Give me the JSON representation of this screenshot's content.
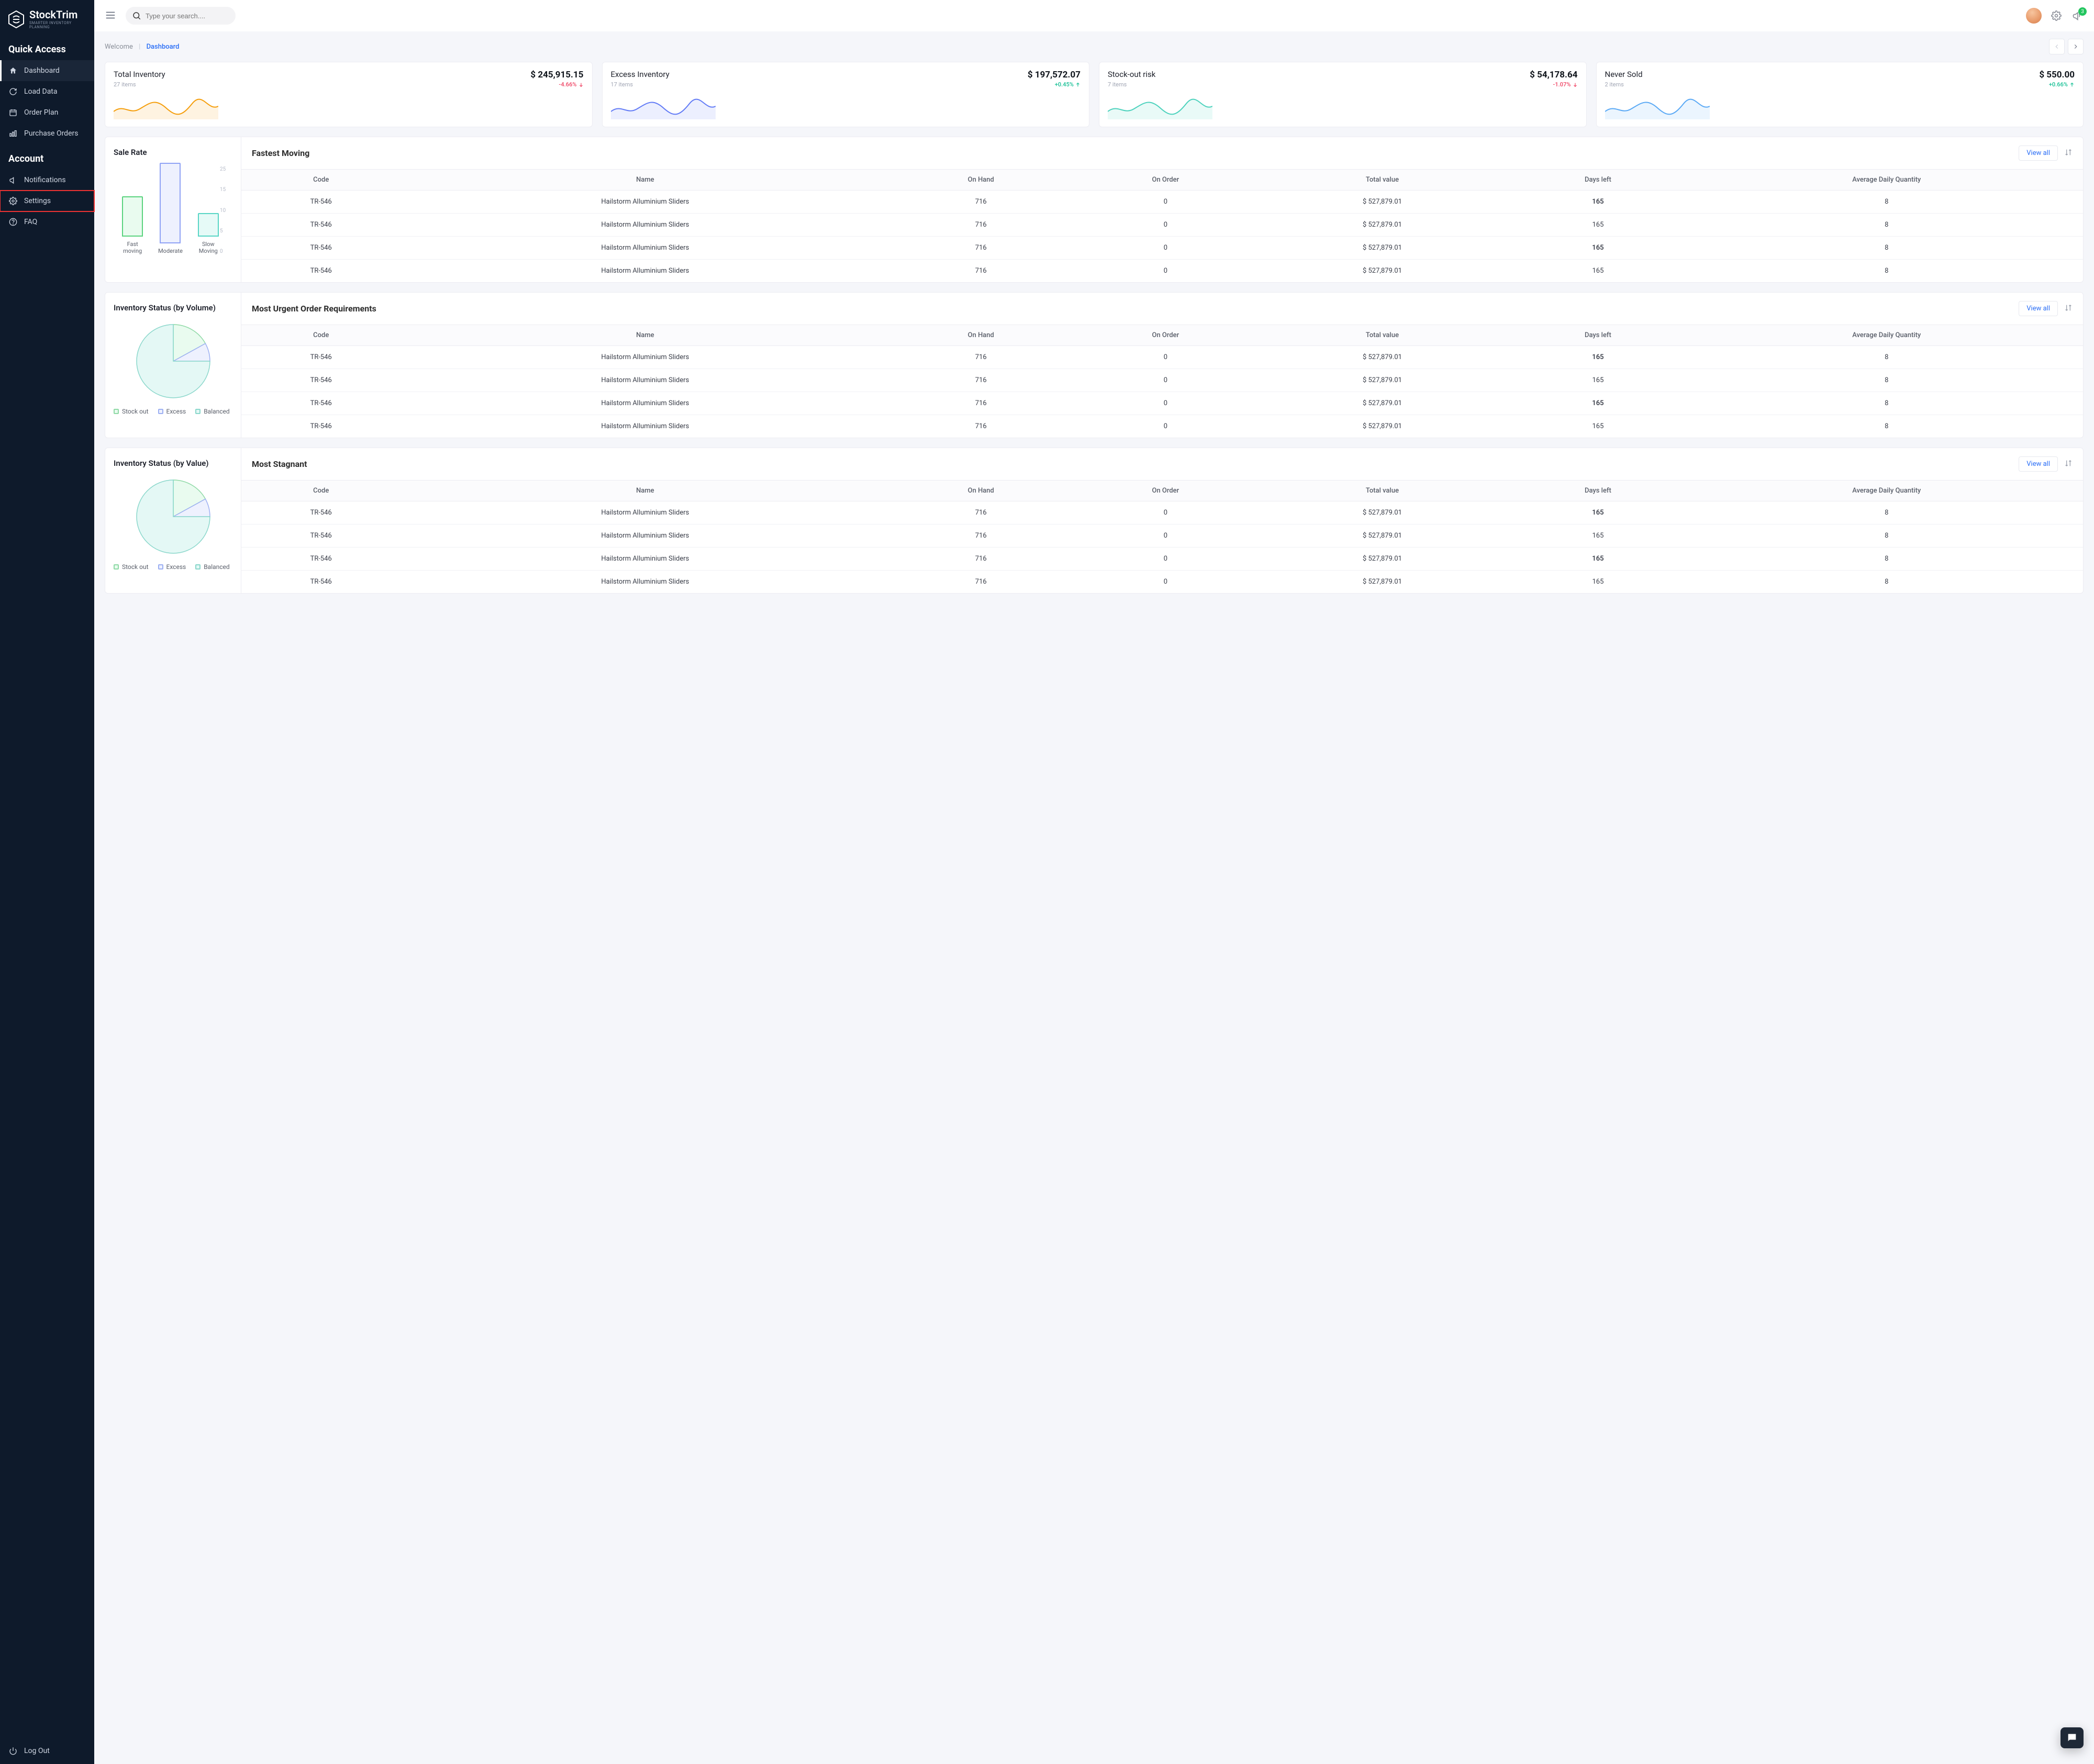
{
  "brand": {
    "name": "StockTrim",
    "tagline": "SMARTER INVENTORY PLANNING"
  },
  "sidebar": {
    "quick_access": "Quick Access",
    "items": [
      {
        "label": "Dashboard",
        "icon": "home",
        "active": true
      },
      {
        "label": "Load Data",
        "icon": "reload"
      },
      {
        "label": "Order Plan",
        "icon": "calendar"
      },
      {
        "label": "Purchase Orders",
        "icon": "bars"
      }
    ],
    "account": "Account",
    "account_items": [
      {
        "label": "Notifications",
        "icon": "megaphone"
      },
      {
        "label": "Settings",
        "icon": "gear",
        "highlighted": true
      },
      {
        "label": "FAQ",
        "icon": "help"
      }
    ],
    "logout": "Log Out"
  },
  "topbar": {
    "search_placeholder": "Type your search....",
    "notif_badge": "3"
  },
  "breadcrumb": {
    "welcome": "Welcome",
    "current": "Dashboard"
  },
  "stats": [
    {
      "title": "Total Inventory",
      "value": "$ 245,915.15",
      "items": "27 items",
      "delta": "-4.66%",
      "dir": "down",
      "color": "#f59e0b"
    },
    {
      "title": "Excess Inventory",
      "value": "$ 197,572.07",
      "items": "17 items",
      "delta": "+0.45%",
      "dir": "up",
      "color": "#627bf6"
    },
    {
      "title": "Stock-out risk",
      "value": "$ 54,178.64",
      "items": "7 items",
      "delta": "-1.07%",
      "dir": "down",
      "color": "#4dd2bd"
    },
    {
      "title": "Never Sold",
      "value": "$ 550.00",
      "items": "2 items",
      "delta": "+0.66%",
      "dir": "up",
      "color": "#5aa9f5"
    }
  ],
  "labels": {
    "view_all": "View all",
    "sale_rate": "Sale Rate",
    "inv_by_volume": "Inventory Status (by Volume)",
    "inv_by_value": "Inventory Status (by Value)",
    "fastest": "Fastest Moving",
    "urgent": "Most Urgent Order Requirements",
    "stagnant": "Most Stagnant"
  },
  "table_headers": [
    "Code",
    "Name",
    "On Hand",
    "On Order",
    "Total value",
    "Days left",
    "Average Daily Quantity"
  ],
  "table_rows": [
    {
      "code": "TR-546",
      "name": "Hailstorm Alluminium Sliders",
      "onhand": "716",
      "onorder": "0",
      "total": "$   527,879.01",
      "days": "165",
      "adq": "8",
      "red": true
    },
    {
      "code": "TR-546",
      "name": "Hailstorm Alluminium Sliders",
      "onhand": "716",
      "onorder": "0",
      "total": "$   527,879.01",
      "days": "165",
      "adq": "8",
      "red": false
    },
    {
      "code": "TR-546",
      "name": "Hailstorm Alluminium Sliders",
      "onhand": "716",
      "onorder": "0",
      "total": "$   527,879.01",
      "days": "165",
      "adq": "8",
      "red": true
    },
    {
      "code": "TR-546",
      "name": "Hailstorm Alluminium Sliders",
      "onhand": "716",
      "onorder": "0",
      "total": "$   527,879.01",
      "days": "165",
      "adq": "8",
      "red": false
    }
  ],
  "pie_legend": [
    "Stock out",
    "Excess",
    "Balanced"
  ],
  "chart_data": [
    {
      "type": "bar",
      "title": "Sale Rate",
      "categories": [
        "Fast moving",
        "Moderate",
        "Slow Moving"
      ],
      "values": [
        12,
        24,
        7
      ],
      "colors_border": [
        "#5ad37e",
        "#8fa2f5",
        "#58d5c5"
      ],
      "colors_fill": [
        "#e9fbef",
        "#eef1fe",
        "#e6faf7"
      ],
      "yticks": [
        25,
        15,
        10,
        5,
        0
      ],
      "ylim": [
        0,
        25
      ]
    },
    {
      "type": "pie",
      "title": "Inventory Status (by Volume)",
      "series": [
        {
          "name": "Stock out",
          "value": 17,
          "fill": "#e9fbef",
          "stroke": "#8fd9a6"
        },
        {
          "name": "Excess",
          "value": 8,
          "fill": "#eef1fe",
          "stroke": "#9db0f2"
        },
        {
          "name": "Balanced",
          "value": 75,
          "fill": "#e4f8f5",
          "stroke": "#8ad7cb"
        }
      ]
    },
    {
      "type": "pie",
      "title": "Inventory Status (by Value)",
      "series": [
        {
          "name": "Stock out",
          "value": 17,
          "fill": "#e9fbef",
          "stroke": "#8fd9a6"
        },
        {
          "name": "Excess",
          "value": 8,
          "fill": "#eef1fe",
          "stroke": "#9db0f2"
        },
        {
          "name": "Balanced",
          "value": 75,
          "fill": "#e4f8f5",
          "stroke": "#8ad7cb"
        }
      ]
    }
  ]
}
